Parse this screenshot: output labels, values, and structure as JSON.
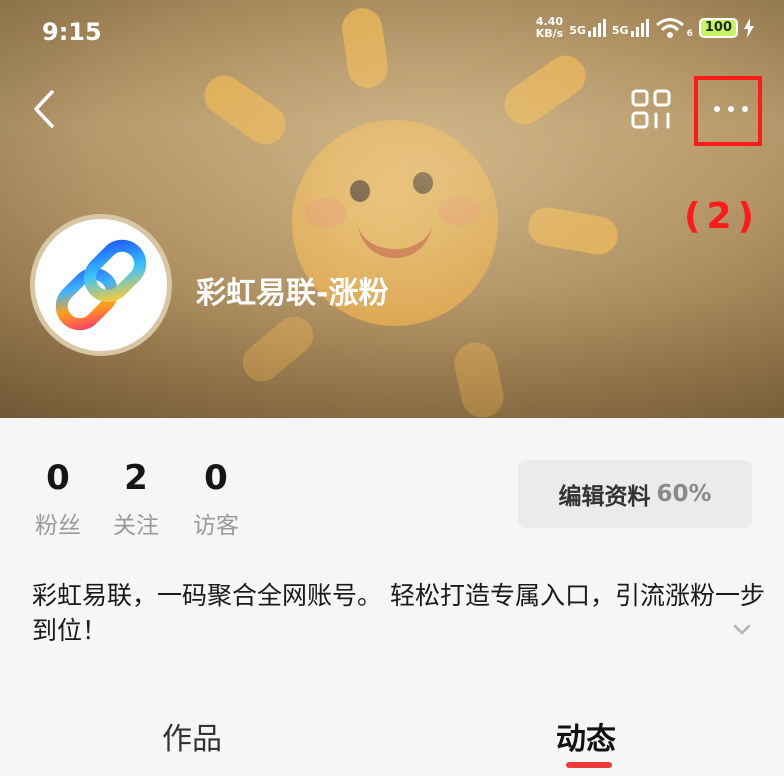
{
  "status_bar": {
    "time": "9:15",
    "net_speed_value": "4.40",
    "net_speed_unit": "KB/s",
    "signal1": "5G",
    "signal2": "5G",
    "wifi_badge": "6",
    "battery": "100"
  },
  "header": {
    "back_icon": "chevron-left-icon",
    "qr_icon": "qr-code-icon",
    "more_icon": "more-dots-icon",
    "annotation": "(2)",
    "annotation_color": "#ff1a1a"
  },
  "profile": {
    "name": "彩虹易联-涨粉",
    "avatar_icon": "rainbow-link-logo"
  },
  "stats": [
    {
      "value": "0",
      "label": "粉丝"
    },
    {
      "value": "2",
      "label": "关注"
    },
    {
      "value": "0",
      "label": "访客"
    }
  ],
  "edit_button": {
    "label": "编辑资料",
    "percent": "60%"
  },
  "bio": "彩虹易联，一码聚合全网账号。 轻松打造专属入口，引流涨粉一步到位！",
  "tabs": [
    {
      "label": "作品",
      "active": false
    },
    {
      "label": "动态",
      "active": true
    }
  ],
  "colors": {
    "accent": "#ef3b3b",
    "annotation": "#ff1a1a"
  }
}
